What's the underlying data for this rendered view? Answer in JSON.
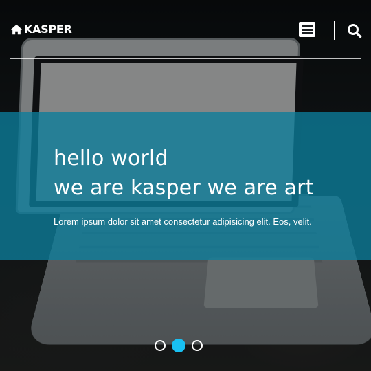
{
  "header": {
    "logo_text": "KASPER",
    "logo_icon": "home-icon",
    "menu_icon": "hamburger-menu-icon",
    "search_icon": "search-icon"
  },
  "hero": {
    "headline_line1": "hello world",
    "headline_line2": "we are kasper we are art",
    "description": "Lorem ipsum dolor sit amet consectetur adipisicing elit. Eos, velit."
  },
  "slider": {
    "count": 3,
    "active_index": 1
  },
  "colors": {
    "banner": "#0b7d9b",
    "active_dot": "#19c1f3",
    "text": "#ffffff"
  }
}
